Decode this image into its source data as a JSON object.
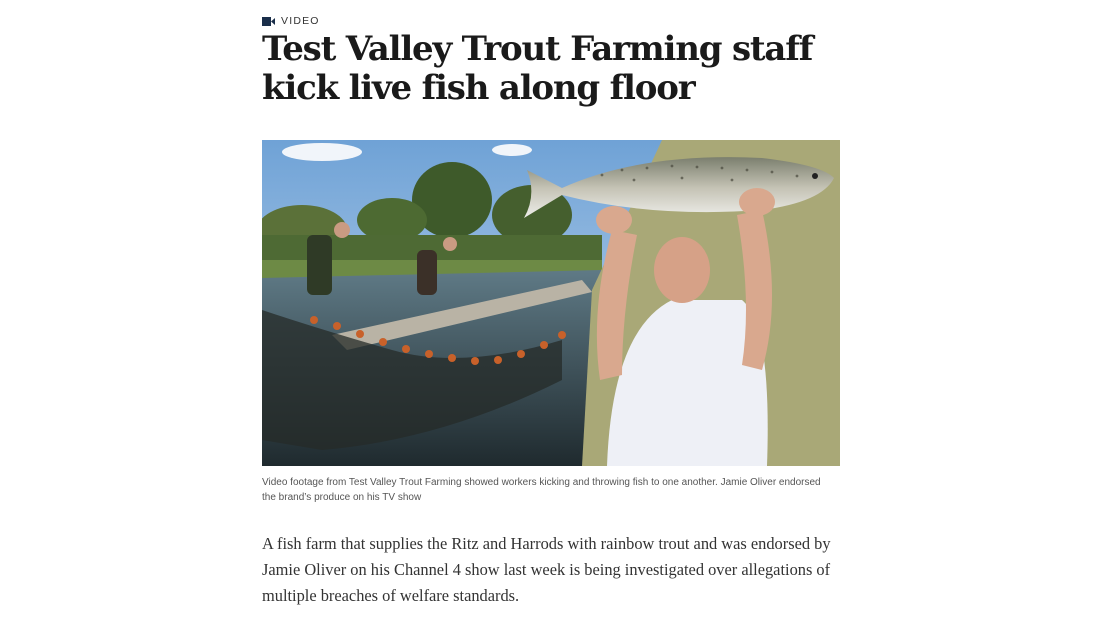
{
  "label": {
    "icon": "video-camera-icon",
    "text": "VIDEO",
    "color": "#1a2e4a"
  },
  "headline": "Test Valley Trout Farming staff kick live fish along floor",
  "image": {
    "description_icon": "photo",
    "colors": {
      "sky": "#8fb8e0",
      "olive_panel": "#a9a877",
      "water": "#34454b"
    }
  },
  "caption": "Video footage from Test Valley Trout Farming showed workers kicking and throwing fish to one another. Jamie Oliver endorsed the brand’s produce on his TV show",
  "lede": "A fish farm that supplies the Ritz and Harrods with rainbow trout and was endorsed by Jamie Oliver on his Channel 4 show last week is being investigated over allegations of multiple breaches of welfare standards."
}
